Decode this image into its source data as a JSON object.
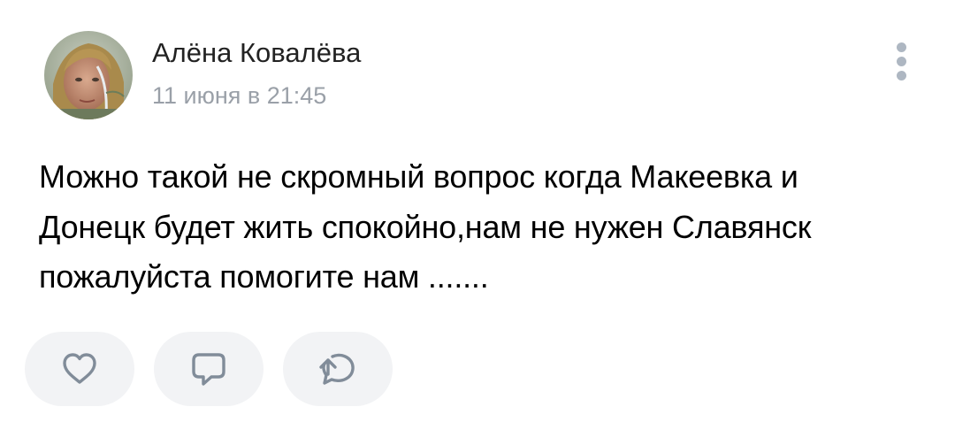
{
  "post": {
    "author": {
      "name": "Алёна Ковалёва",
      "avatar_alt": "avatar"
    },
    "timestamp": "11 июня в 21:45",
    "text": "Можно такой не скромный вопрос когда Макеевка и\nДонецк будет жить спокойно,нам не нужен Славянск\nпожалуйста помогите нам .......",
    "actions": {
      "like_icon": "heart-icon",
      "comment_icon": "comment-icon",
      "share_icon": "share-icon"
    },
    "more_icon": "more-vertical-icon"
  },
  "colors": {
    "background": "#ffffff",
    "author_name": "#222222",
    "timestamp": "#9aa0a8",
    "text": "#000000",
    "action_bg": "#f2f3f5",
    "action_icon": "#818c99",
    "more_dots": "#aeb7c2"
  }
}
